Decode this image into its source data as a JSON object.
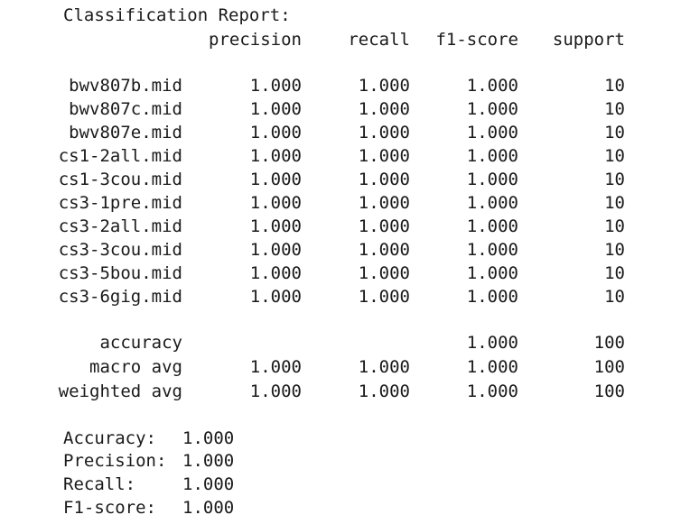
{
  "report": {
    "title": "Classification Report:",
    "headers": {
      "precision": "precision",
      "recall": "recall",
      "f1": "f1-score",
      "support": "support"
    },
    "rows": [
      {
        "label": "bwv807b.mid",
        "precision": "1.000",
        "recall": "1.000",
        "f1": "1.000",
        "support": "10"
      },
      {
        "label": "bwv807c.mid",
        "precision": "1.000",
        "recall": "1.000",
        "f1": "1.000",
        "support": "10"
      },
      {
        "label": "bwv807e.mid",
        "precision": "1.000",
        "recall": "1.000",
        "f1": "1.000",
        "support": "10"
      },
      {
        "label": "cs1-2all.mid",
        "precision": "1.000",
        "recall": "1.000",
        "f1": "1.000",
        "support": "10"
      },
      {
        "label": "cs1-3cou.mid",
        "precision": "1.000",
        "recall": "1.000",
        "f1": "1.000",
        "support": "10"
      },
      {
        "label": "cs3-1pre.mid",
        "precision": "1.000",
        "recall": "1.000",
        "f1": "1.000",
        "support": "10"
      },
      {
        "label": "cs3-2all.mid",
        "precision": "1.000",
        "recall": "1.000",
        "f1": "1.000",
        "support": "10"
      },
      {
        "label": "cs3-3cou.mid",
        "precision": "1.000",
        "recall": "1.000",
        "f1": "1.000",
        "support": "10"
      },
      {
        "label": "cs3-5bou.mid",
        "precision": "1.000",
        "recall": "1.000",
        "f1": "1.000",
        "support": "10"
      },
      {
        "label": "cs3-6gig.mid",
        "precision": "1.000",
        "recall": "1.000",
        "f1": "1.000",
        "support": "10"
      }
    ],
    "accuracy": {
      "label": "accuracy",
      "f1": "1.000",
      "support": "100"
    },
    "macro_avg": {
      "label": "macro avg",
      "precision": "1.000",
      "recall": "1.000",
      "f1": "1.000",
      "support": "100"
    },
    "weighted_avg": {
      "label": "weighted avg",
      "precision": "1.000",
      "recall": "1.000",
      "f1": "1.000",
      "support": "100"
    }
  },
  "summary": [
    {
      "label": "Accuracy:",
      "value": "1.000"
    },
    {
      "label": "Precision:",
      "value": "1.000"
    },
    {
      "label": "Recall:",
      "value": "1.000"
    },
    {
      "label": "F1-score:",
      "value": "1.000"
    }
  ]
}
